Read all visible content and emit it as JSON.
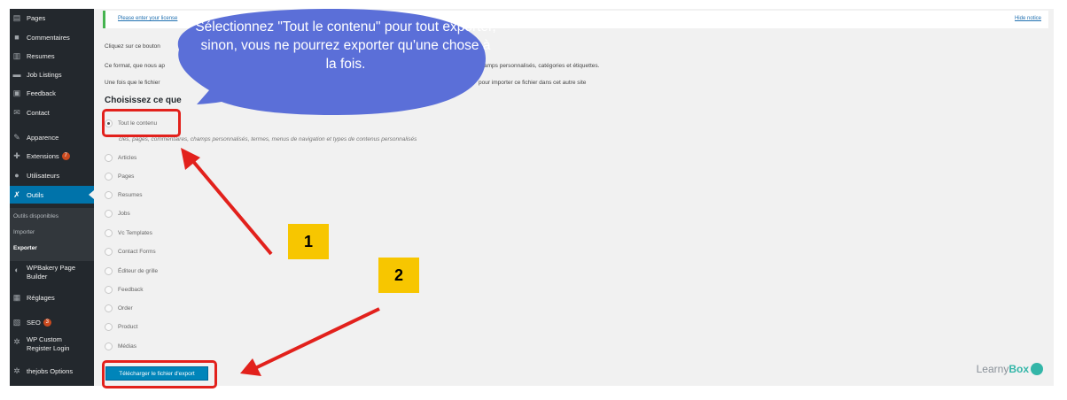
{
  "sidebar": {
    "items": [
      {
        "label": "Pages",
        "icon": "pages-icon"
      },
      {
        "label": "Commentaires",
        "icon": "comment-icon"
      },
      {
        "label": "Resumes",
        "icon": "document-icon"
      },
      {
        "label": "Job Listings",
        "icon": "briefcase-icon"
      },
      {
        "label": "Feedback",
        "icon": "feedback-icon"
      },
      {
        "label": "Contact",
        "icon": "mail-icon"
      },
      {
        "label": "Apparence",
        "icon": "brush-icon"
      },
      {
        "label": "Extensions",
        "icon": "plugin-icon",
        "badge": "7"
      },
      {
        "label": "Utilisateurs",
        "icon": "user-icon"
      },
      {
        "label": "Outils",
        "icon": "wrench-icon"
      },
      {
        "label": "WPBakery Page Builder",
        "icon": "builder-icon"
      },
      {
        "label": "Réglages",
        "icon": "settings-icon"
      },
      {
        "label": "SEO",
        "icon": "seo-icon",
        "badge": "3"
      },
      {
        "label": "WP Custom Register Login",
        "icon": "gear-icon"
      },
      {
        "label": "thejobs Options",
        "icon": "gear-icon"
      }
    ],
    "submenu": [
      "Outils disponibles",
      "Importer",
      "Exporter"
    ]
  },
  "notice": {
    "text": "Please enter your license",
    "hide": "Hide notice"
  },
  "paragraphs": [
    "Cliquez sur ce bouton",
    "Ce format, que nous ap",
    "amps personnalisés, catégories et étiquettes.",
    "Une fois que le fichier",
    "pour importer ce fichier dans cet autre site"
  ],
  "choose_title": "Choisissez ce que",
  "options": {
    "all_label": "Tout le contenu",
    "all_desc": "cles, pages, commentaires, champs personnalisés, termes, menus de navigation et types de contenus personnalisés",
    "items": [
      "Articles",
      "Pages",
      "Resumes",
      "Jobs",
      "Vc Templates",
      "Contact Forms",
      "Éditeur de grille",
      "Feedback",
      "Order",
      "Product",
      "Médias"
    ]
  },
  "download_button": "Télécharger le fichier d'export",
  "callout": "Sélectionnez \"Tout le contenu\" pour tout exporter, sinon, vous ne pourrez exporter qu'une chose à la fois.",
  "steps": {
    "one": "1",
    "two": "2"
  },
  "logo": {
    "text": "Learny",
    "accent": "Box"
  },
  "colors": {
    "sidebar": "#23282d",
    "active": "#0073aa",
    "bubble": "#5b6fd8",
    "highlight": "#e2211c",
    "badge": "#f7c600",
    "button": "#0085ba"
  }
}
